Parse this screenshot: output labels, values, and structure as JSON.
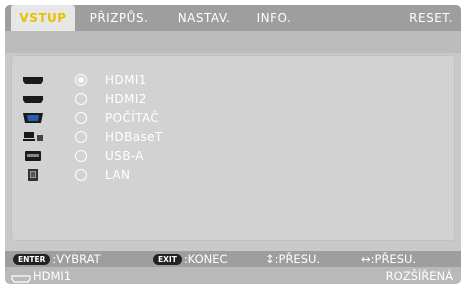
{
  "tabs": [
    "VSTUP",
    "PŘIZPŮS.",
    "NASTAV.",
    "INFO.",
    "RESET."
  ],
  "inputs": [
    {
      "label": "HDMI1",
      "icon": "hdmi-icon",
      "selected": true
    },
    {
      "label": "HDMI2",
      "icon": "hdmi-icon",
      "selected": false
    },
    {
      "label": "POČÍTAČ",
      "icon": "vga-icon",
      "selected": false
    },
    {
      "label": "HDBaseT",
      "icon": "hdbaset-icon",
      "selected": false
    },
    {
      "label": "USB-A",
      "icon": "usb-icon",
      "selected": false
    },
    {
      "label": "LAN",
      "icon": "lan-icon",
      "selected": false
    }
  ],
  "footer": {
    "enter_key": "ENTER",
    "enter_label": ":VYBRAT",
    "exit_key": "EXIT",
    "exit_label": ":KONEC",
    "move_v_label": "↕:PŘESU.",
    "move_h_label": "↔:PŘESU."
  },
  "status": {
    "source": "HDMI1",
    "mode": "ROZŠÍŘENÁ"
  },
  "colors": {
    "active_tab_text": "#e8c000",
    "bar": "#9e9e9e",
    "panel": "#d2d2d2"
  }
}
